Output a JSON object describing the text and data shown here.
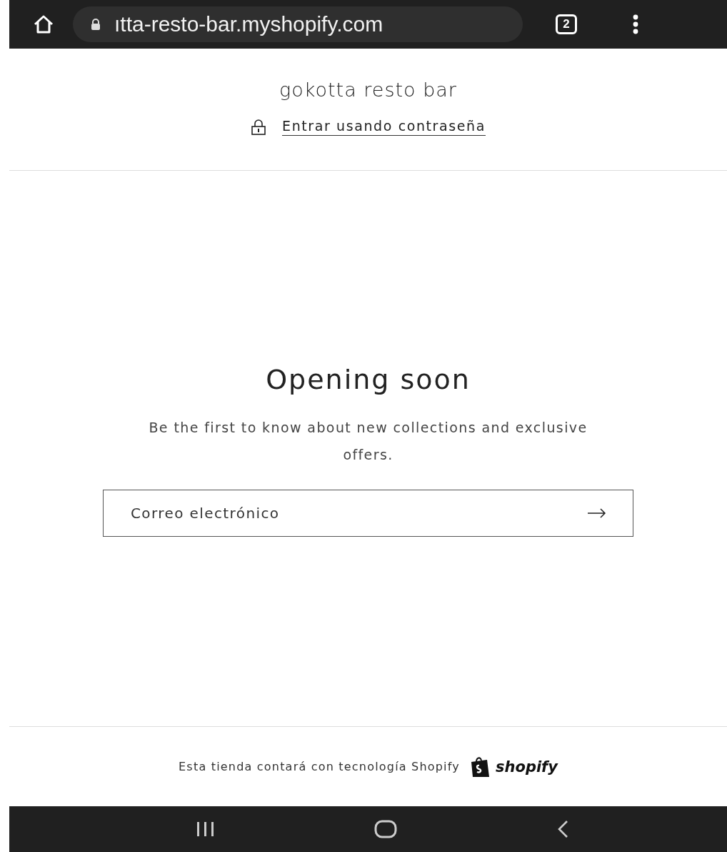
{
  "browser": {
    "url": "ıtta-resto-bar.myshopify.com",
    "tab_count": "2"
  },
  "header": {
    "store_name": "gokotta resto bar",
    "password_link": "Entrar usando contraseña"
  },
  "hero": {
    "heading": "Opening soon",
    "text": "Be the first to know about new collections and exclusive offers."
  },
  "newsletter": {
    "placeholder": "Correo electrónico"
  },
  "footer": {
    "text": "Esta tienda contará con tecnología Shopify",
    "brand": "shopify"
  }
}
